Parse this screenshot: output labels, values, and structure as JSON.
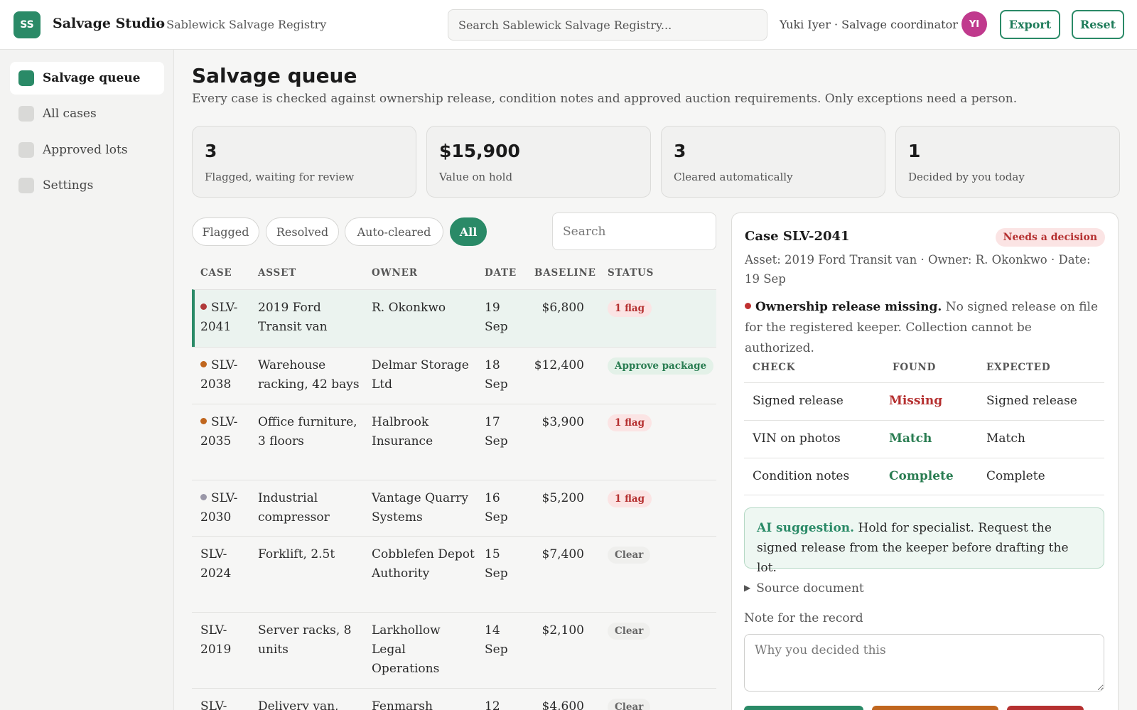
{
  "header": {
    "logo": "SS",
    "app_name": "Salvage Studio",
    "registry": "· Sablewick Salvage Registry",
    "search_placeholder": "Search Sablewick Salvage Registry...",
    "user": "Yuki Iyer · Salvage coordinator",
    "avatar": "YI",
    "export_label": "Export",
    "reset_label": "Reset"
  },
  "sidebar": {
    "items": [
      {
        "label": "Salvage queue"
      },
      {
        "label": "All cases"
      },
      {
        "label": "Approved lots"
      },
      {
        "label": "Settings"
      }
    ]
  },
  "main": {
    "title": "Salvage queue",
    "subtitle": "Every case is checked against ownership release, condition notes and approved auction requirements. Only exceptions need a person.",
    "stats": [
      {
        "value": "3",
        "label": "Flagged, waiting for review"
      },
      {
        "value": "$15,900",
        "label": "Value on hold"
      },
      {
        "value": "3",
        "label": "Cleared automatically"
      },
      {
        "value": "1",
        "label": "Decided by you today"
      }
    ],
    "filters": [
      "Flagged",
      "Resolved",
      "Auto-cleared",
      "All"
    ],
    "table_search_placeholder": "Search",
    "columns": [
      "CASE",
      "ASSET",
      "OWNER",
      "DATE",
      "BASELINE",
      "STATUS"
    ],
    "rows": [
      {
        "case1": "SLV-",
        "case2": "2041",
        "asset": "2019 Ford Transit van",
        "owner": "R. Okonkwo",
        "date1": "19",
        "date2": "Sep",
        "baseline": "$6,800",
        "status": "1 flag"
      },
      {
        "case1": "SLV-",
        "case2": "2038",
        "asset": "Warehouse racking, 42 bays",
        "owner": "Delmar Storage Ltd",
        "date1": "18",
        "date2": "Sep",
        "baseline": "$12,400",
        "status": "Approve package"
      },
      {
        "case1": "SLV-",
        "case2": "2035",
        "asset": "Office furniture, 3 floors",
        "owner": "Halbrook Insurance",
        "date1": "17",
        "date2": "Sep",
        "baseline": "$3,900",
        "status": "1 flag"
      },
      {
        "case1": "SLV-",
        "case2": "2030",
        "asset": "Industrial compressor",
        "owner": "Vantage Quarry Systems",
        "date1": "16",
        "date2": "Sep",
        "baseline": "$5,200",
        "status": "1 flag"
      },
      {
        "case1": "SLV-",
        "case2": "2024",
        "asset": "Forklift, 2.5t",
        "owner": "Cobblefen Depot Authority",
        "date1": "15",
        "date2": "Sep",
        "baseline": "$7,400",
        "status": "Clear"
      },
      {
        "case1": "SLV-",
        "case2": "2019",
        "asset": "Server racks, 8 units",
        "owner": "Larkhollow Legal Operations",
        "date1": "14",
        "date2": "Sep",
        "baseline": "$2,100",
        "status": "Clear"
      },
      {
        "case1": "SLV-",
        "case2": "",
        "asset": "Delivery van,",
        "owner": "Fenmarsh",
        "date1": "12",
        "date2": "",
        "baseline": "$4,600",
        "status": "Clear"
      }
    ]
  },
  "detail": {
    "title": "Case SLV-2041",
    "badge": "Needs a decision",
    "meta": "Asset: 2019 Ford Transit van · Owner: R. Okonkwo · Date: 19 Sep",
    "issue_title": "Ownership release missing.",
    "issue_text": "No signed release on file for the registered keeper. Collection cannot be authorized.",
    "check_columns": [
      "CHECK",
      "FOUND",
      "EXPECTED"
    ],
    "checks": [
      {
        "check": "Signed release",
        "found": "Missing",
        "expected": "Signed release"
      },
      {
        "check": "VIN on photos",
        "found": "Match",
        "expected": "Match"
      },
      {
        "check": "Condition notes",
        "found": "Complete",
        "expected": "Complete"
      }
    ],
    "ai_label": "AI suggestion.",
    "ai_text": "Hold for specialist. Request the signed release from the keeper before drafting the lot.",
    "source_doc": "Source document",
    "note_label": "Note for the record",
    "note_placeholder": "Why you decided this"
  },
  "colors": {
    "accent": "#2a8a67",
    "flag": "#b53030",
    "dot_red": "#b03a3a",
    "dot_orange": "#c0661e",
    "dot_gray": "#9a97a8"
  }
}
